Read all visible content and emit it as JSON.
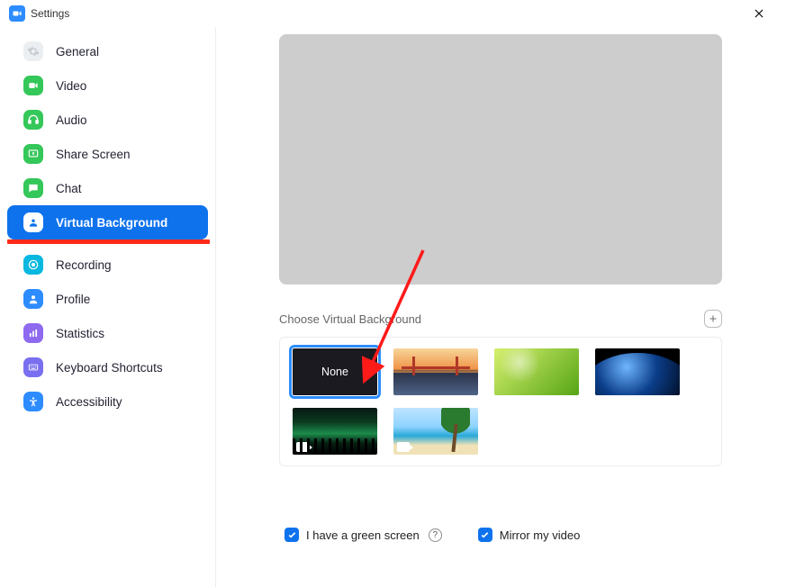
{
  "window": {
    "title": "Settings"
  },
  "sidebar": {
    "items": [
      {
        "label": "General"
      },
      {
        "label": "Video"
      },
      {
        "label": "Audio"
      },
      {
        "label": "Share Screen"
      },
      {
        "label": "Chat"
      },
      {
        "label": "Virtual Background"
      },
      {
        "label": "Recording"
      },
      {
        "label": "Profile"
      },
      {
        "label": "Statistics"
      },
      {
        "label": "Keyboard Shortcuts"
      },
      {
        "label": "Accessibility"
      }
    ],
    "selected_index": 5
  },
  "main": {
    "section_title": "Choose Virtual Background",
    "backgrounds": {
      "none_label": "None",
      "selected_index": 0,
      "items": [
        {
          "name": "none"
        },
        {
          "name": "golden-gate-bridge"
        },
        {
          "name": "grass"
        },
        {
          "name": "earth-from-space"
        },
        {
          "name": "aurora",
          "is_video": true
        },
        {
          "name": "tropical-beach",
          "is_video": true
        }
      ]
    },
    "options": {
      "green_screen": {
        "label": "I have a green screen",
        "checked": true
      },
      "mirror": {
        "label": "Mirror my video",
        "checked": true
      }
    }
  }
}
